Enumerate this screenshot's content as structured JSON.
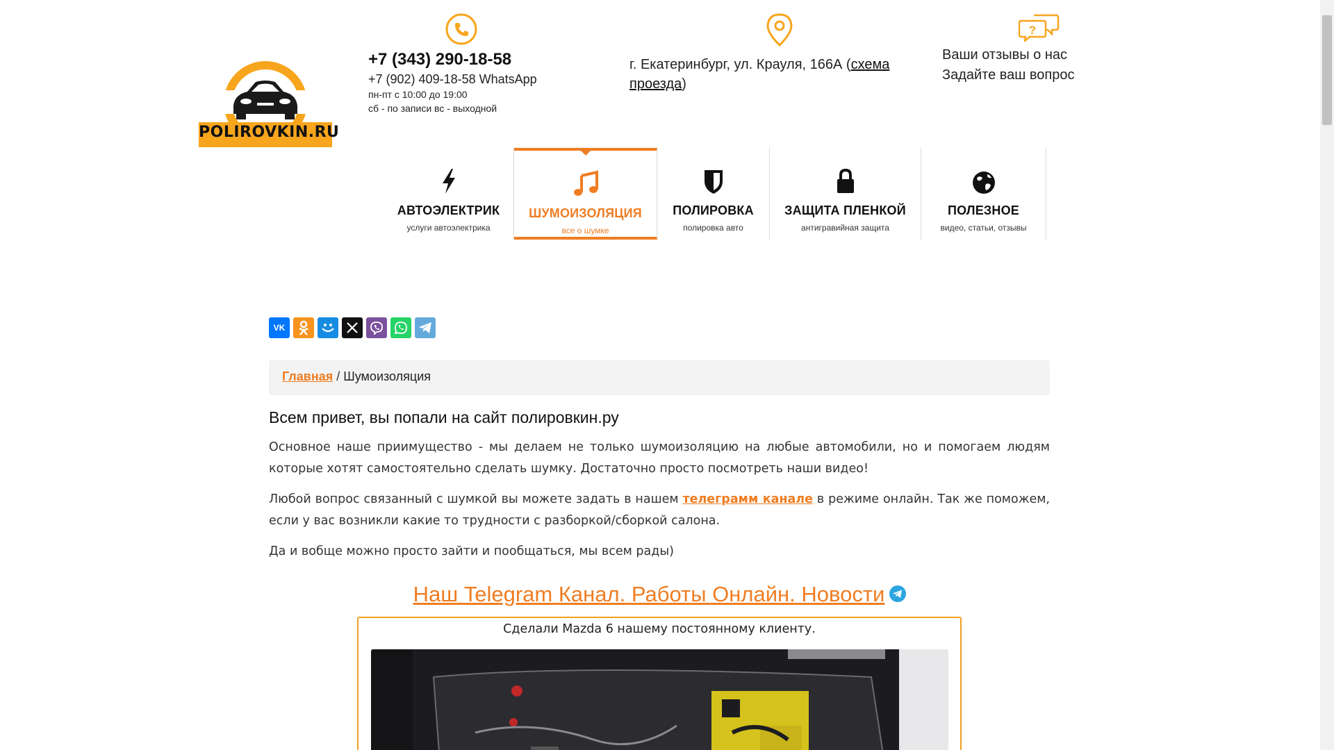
{
  "header": {
    "logo_text": "POLIROVKIN.RU",
    "phone_main": "+7 (343) 290-18-58",
    "phone_alt": "+7 (902) 409-18-58 WhatsApp",
    "hours_weekdays": "пн-пт с 10:00 до 19:00",
    "hours_weekend": "сб - по записи вс - выходной",
    "address_prefix": "г. Екатеринбург, ул. Крауля, 166А (",
    "address_link": "схема проезда",
    "address_suffix": ")",
    "reviews_line1": "Ваши отзывы о нас",
    "reviews_line2": "Задайте ваш вопрос"
  },
  "nav": {
    "items": [
      {
        "title": "АВТОЭЛЕКТРИК",
        "sub": "услуги автоэлектрика",
        "icon": "lightning-icon"
      },
      {
        "title": "ШУМОИЗОЛЯЦИЯ",
        "sub": "все о шумке",
        "icon": "music-note-icon",
        "active": true
      },
      {
        "title": "ПОЛИРОВКА",
        "sub": "полировка авто",
        "icon": "shield-icon"
      },
      {
        "title": "ЗАЩИТА ПЛЕНКОЙ",
        "sub": "антигравийная защита",
        "icon": "lock-icon"
      },
      {
        "title": "ПОЛЕЗНОЕ",
        "sub": "видео, статьи, отзывы",
        "icon": "globe-icon"
      }
    ]
  },
  "share": {
    "buttons": [
      {
        "name": "vk",
        "label": "VK",
        "color": "#0077ff"
      },
      {
        "name": "ok",
        "label": "ок",
        "color": "#f7931e"
      },
      {
        "name": "mailru",
        "label": "☺",
        "color": "#168de2"
      },
      {
        "name": "x",
        "label": "X",
        "color": "#111111"
      },
      {
        "name": "viber",
        "label": "☏",
        "color": "#7b519d"
      },
      {
        "name": "whatsapp",
        "label": "✆",
        "color": "#25d366"
      },
      {
        "name": "telegram",
        "label": "➤",
        "color": "#64a9dc"
      }
    ]
  },
  "breadcrumbs": {
    "home": "Главная",
    "separator": "/",
    "current": "Шумоизоляция"
  },
  "content": {
    "intro_heading": "Всем привет, вы попали на сайт полировкин.ру",
    "para1": "Основное наше приимущество - мы делаем не только шумоизоляцию на любые автомобили, но и помогаем людям которые хотят самостоятельно сделать шумку. Достаточно просто посмотреть наши видео!",
    "para2_before": "Любой вопрос связанный с шумкой вы можете задать в нашем ",
    "para2_link": "телеграмм канале",
    "para2_after": " в режиме онлайн. Так же поможем, если у вас возникли какие то трудности с разборкой/сборкой салона.",
    "para3": "Да и вобще можно просто зайти и пообщаться, мы всем рады)",
    "telegram_link": "Наш Telegram Канал. Работы Онлайн. Новости"
  },
  "post": {
    "caption": "Сделали Mazda 6 нашему постоянному клиенту."
  },
  "colors": {
    "accent": "#ef7d22",
    "logo_yellow": "#f7a51d",
    "post_border": "#f0a020"
  }
}
